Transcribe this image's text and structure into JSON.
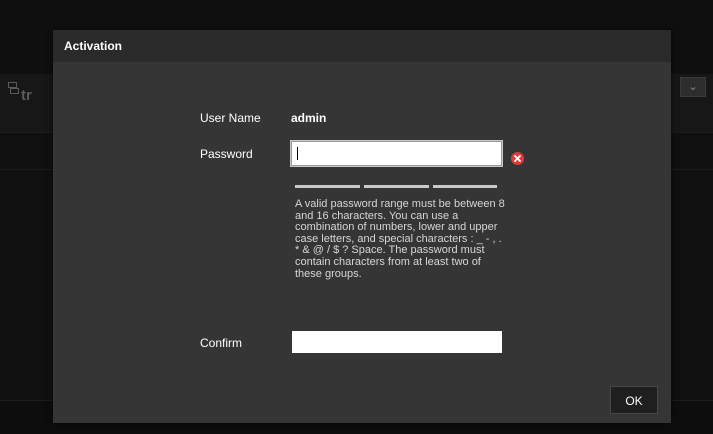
{
  "background": {
    "logo_text": "tr",
    "select_chevron": "chevron-down-icon"
  },
  "dialog": {
    "title": "Activation",
    "user_name_label": "User Name",
    "user_name_value": "admin",
    "password_label": "Password",
    "password_value": "",
    "password_hint": "A valid password range must be between 8 and 16 characters. You can use a combination of numbers, lower and upper case letters, and special characters : _ - , . * & @ / $ ? Space. The password must contain characters from at least two of these groups.",
    "confirm_label": "Confirm",
    "confirm_value": "",
    "ok_label": "OK",
    "error_icon": "error-x-icon",
    "error_color": "#e03a3a"
  }
}
